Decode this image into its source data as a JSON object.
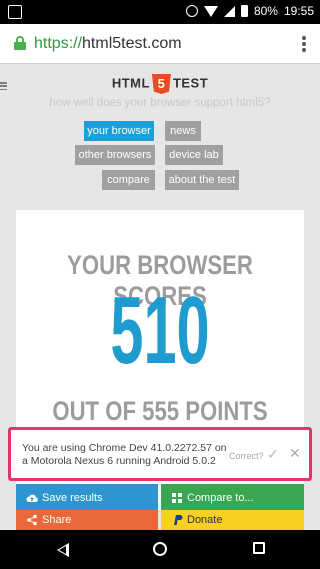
{
  "status_bar": {
    "battery": "80%",
    "time": "19:55",
    "icons": [
      "alarm-icon",
      "wifi-icon",
      "signal-icon",
      "battery-icon"
    ]
  },
  "browser": {
    "url_scheme": "https://",
    "url_host": "html5test.com"
  },
  "site": {
    "logo_left": "HTML",
    "logo_five": "5",
    "logo_right": "TEST",
    "tagline": "how well does your browser support html5?",
    "nav": [
      {
        "label": "your browser",
        "active": true
      },
      {
        "label": "news",
        "active": false
      },
      {
        "label": "other browsers",
        "active": false
      },
      {
        "label": "device lab",
        "active": false
      },
      {
        "label": "compare",
        "active": false
      },
      {
        "label": "about the test",
        "active": false
      }
    ]
  },
  "score": {
    "headline": "YOUR BROWSER SCORES",
    "value": "510",
    "out_of": "OUT OF 555 POINTS"
  },
  "notice": {
    "text": "You are using Chrome Dev 41.0.2272.57 on a Motorola Nexus 6 running Android 5.0.2",
    "correct_label": "Correct?",
    "check_glyph": "✓",
    "close_glyph": "✕"
  },
  "actions": {
    "save": "Save results",
    "compare": "Compare to...",
    "share": "Share",
    "donate": "Donate"
  },
  "colors": {
    "accent": "#1e9bcf",
    "highlight_border": "#e6336a",
    "save": "#2e96cf",
    "compare": "#3aa652",
    "share": "#e8683a",
    "donate": "#f7d022"
  }
}
